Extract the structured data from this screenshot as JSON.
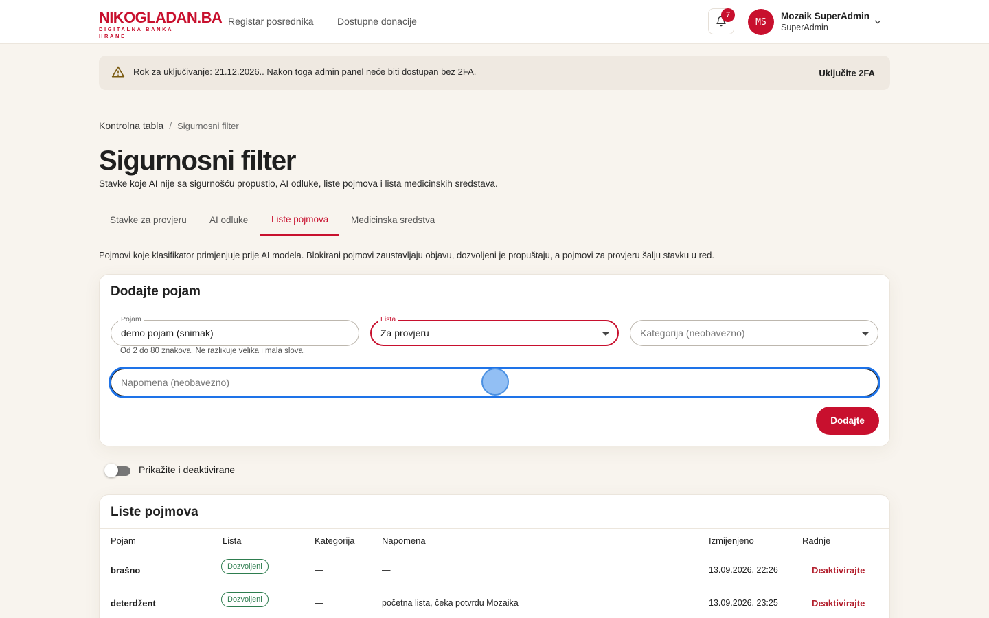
{
  "header": {
    "logo_main": "NIKOGLADAN",
    "logo_tld": ".BA",
    "logo_sub": "DIGITALNA BANKA HRANE",
    "nav": [
      "Registar posrednika",
      "Dostupne donacije"
    ],
    "notification_count": "7",
    "user": {
      "initials": "MS",
      "name": "Mozaik SuperAdmin",
      "role": "SuperAdmin"
    }
  },
  "alert": {
    "text": "Rok za uključivanje: 21.12.2026.. Nakon toga admin panel neće biti dostupan bez 2FA.",
    "action": "Uključite 2FA"
  },
  "breadcrumb": {
    "parent": "Kontrolna tabla",
    "separator": "/",
    "current": "Sigurnosni filter"
  },
  "page": {
    "title": "Sigurnosni filter",
    "subtitle": "Stavke koje AI nije sa sigurnošću propustio, AI odluke, liste pojmova i lista medicinskih sredstava."
  },
  "tabs": [
    {
      "label": "Stavke za provjeru",
      "active": false
    },
    {
      "label": "AI odluke",
      "active": false
    },
    {
      "label": "Liste pojmova",
      "active": true
    },
    {
      "label": "Medicinska sredstva",
      "active": false
    }
  ],
  "intro": "Pojmovi koje klasifikator primjenjuje prije AI modela. Blokirani pojmovi zaustavljaju objavu, dozvoljeni je propuštaju, a pojmovi za provjeru šalju stavku u red.",
  "add_form": {
    "title": "Dodajte pojam",
    "term": {
      "label": "Pojam",
      "value": "demo pojam (snimak)",
      "helper": "Od 2 do 80 znakova. Ne razlikuje velika i mala slova."
    },
    "list": {
      "label": "Lista",
      "value": "Za provjeru"
    },
    "category": {
      "placeholder": "Kategorija (neobavezno)"
    },
    "note": {
      "placeholder": "Napomena (neobavezno)"
    },
    "submit": "Dodajte"
  },
  "toggle": {
    "label": "Prikažite i deaktivirane",
    "checked": false
  },
  "table": {
    "title": "Liste pojmova",
    "columns": [
      "Pojam",
      "Lista",
      "Kategorija",
      "Napomena",
      "Izmijenjeno",
      "Radnje"
    ],
    "rows": [
      {
        "term": "brašno",
        "list": "Dozvoljeni",
        "category": "—",
        "note": "—",
        "modified": "13.09.2026. 22:26",
        "action": "Deaktivirajte"
      },
      {
        "term": "deterdžent",
        "list": "Dozvoljeni",
        "category": "—",
        "note": "početna lista, čeka potvrdu Mozaika",
        "modified": "13.09.2026. 23:25",
        "action": "Deaktivirajte"
      }
    ]
  },
  "colors": {
    "brand": "#c8102e",
    "focus": "#1e73e8",
    "badge_green": "#2e7d4f",
    "background": "#f8f4ee"
  }
}
